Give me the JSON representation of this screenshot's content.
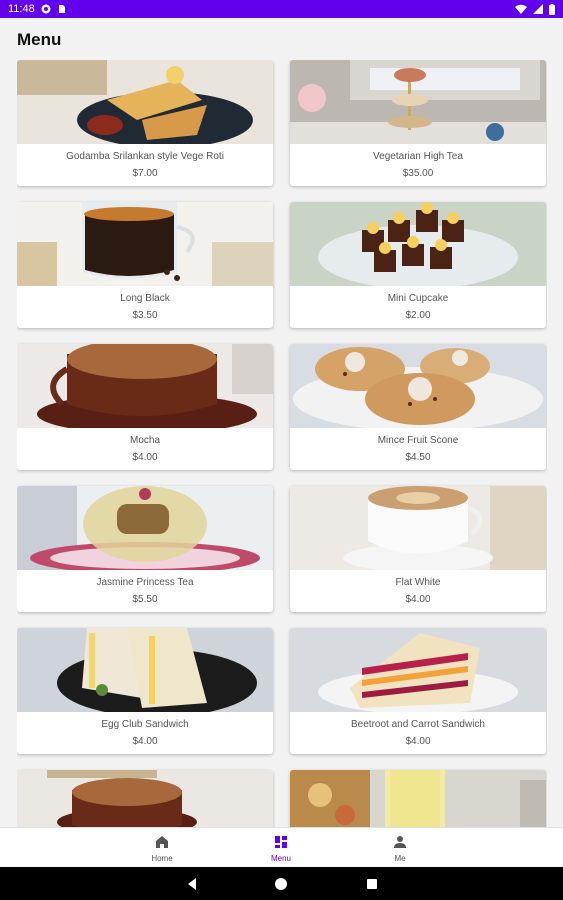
{
  "status_bar": {
    "time": "11:48"
  },
  "page": {
    "title": "Menu"
  },
  "menu_items": [
    {
      "name": "Godamba Srilankan style Vege Roti",
      "price": "$7.00"
    },
    {
      "name": "Vegetarian High Tea",
      "price": "$35.00"
    },
    {
      "name": "Long Black",
      "price": "$3.50"
    },
    {
      "name": "Mini Cupcake",
      "price": "$2.00"
    },
    {
      "name": "Mocha",
      "price": "$4.00"
    },
    {
      "name": "Mince Fruit Scone",
      "price": "$4.50"
    },
    {
      "name": "Jasmine Princess Tea",
      "price": "$5.50"
    },
    {
      "name": "Flat White",
      "price": "$4.00"
    },
    {
      "name": "Egg Club Sandwich",
      "price": "$4.00"
    },
    {
      "name": "Beetroot and Carrot Sandwich",
      "price": "$4.00"
    },
    {
      "name": "",
      "price": ""
    },
    {
      "name": "",
      "price": ""
    }
  ],
  "bottom_nav": {
    "items": [
      {
        "label": "Home",
        "icon": "home-icon"
      },
      {
        "label": "Menu",
        "icon": "menu-grid-icon",
        "active": true
      },
      {
        "label": "Me",
        "icon": "person-icon"
      }
    ]
  },
  "colors": {
    "accent": "#6200ee",
    "status_bar": "#6200ee",
    "background": "#f2f2f2"
  }
}
